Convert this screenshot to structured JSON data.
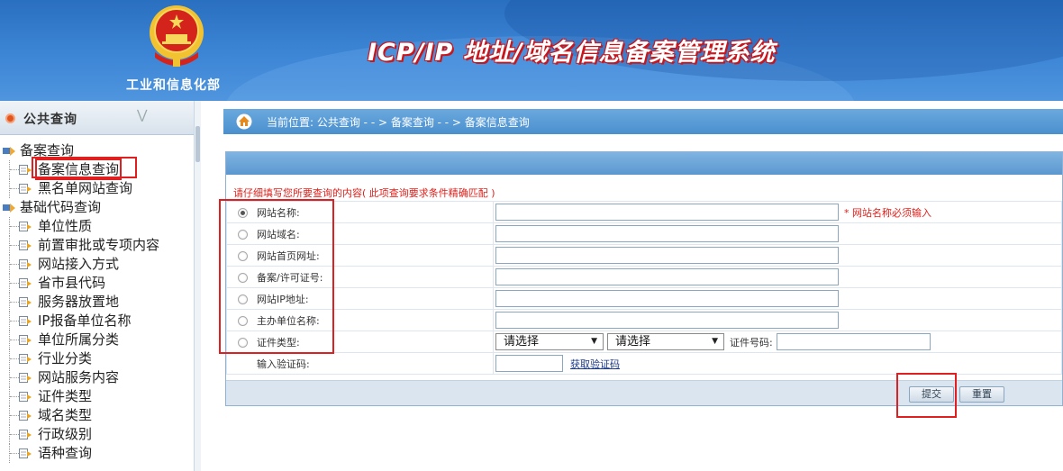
{
  "header": {
    "org_name": "工业和信息化部",
    "system_title": "ICP/IP 地址/域名信息备案管理系统",
    "brand_colors": {
      "header_blue": "#2f78c8",
      "title_shadow_red": "#c8161d"
    }
  },
  "sidebar": {
    "section_title": "公共查询",
    "groups": [
      {
        "label": "备案查询",
        "items": [
          "备案信息查询",
          "黑名单网站查询"
        ]
      },
      {
        "label": "基础代码查询",
        "items": [
          "单位性质",
          "前置审批或专项内容",
          "网站接入方式",
          "省市县代码",
          "服务器放置地",
          "IP报备单位名称",
          "单位所属分类",
          "行业分类",
          "网站服务内容",
          "证件类型",
          "域名类型",
          "行政级别",
          "语种查询"
        ]
      }
    ],
    "selected_item": "备案信息查询"
  },
  "breadcrumb": {
    "text": "当前位置: 公共查询   - - > 备案查询   - - > 备案信息查询"
  },
  "form": {
    "hint": "请仔细填写您所要查询的内容( 此项查询要求条件精确匹配 )",
    "fields": [
      {
        "label": "网站名称:",
        "checked": true,
        "value": "",
        "note": "* 网站名称必须输入"
      },
      {
        "label": "网站域名:",
        "checked": false,
        "value": ""
      },
      {
        "label": "网站首页网址:",
        "checked": false,
        "value": ""
      },
      {
        "label": "备案/许可证号:",
        "checked": false,
        "value": ""
      },
      {
        "label": "网站IP地址:",
        "checked": false,
        "value": ""
      },
      {
        "label": "主办单位名称:",
        "checked": false,
        "value": ""
      }
    ],
    "cert": {
      "label": "证件类型:",
      "select1": "请选择",
      "select2": "请选择",
      "cert_no_label": "证件号码:",
      "cert_no_value": ""
    },
    "captcha": {
      "label": "输入验证码:",
      "value": "",
      "link": "获取验证码"
    },
    "buttons": {
      "submit": "提交",
      "reset": "重置"
    }
  }
}
